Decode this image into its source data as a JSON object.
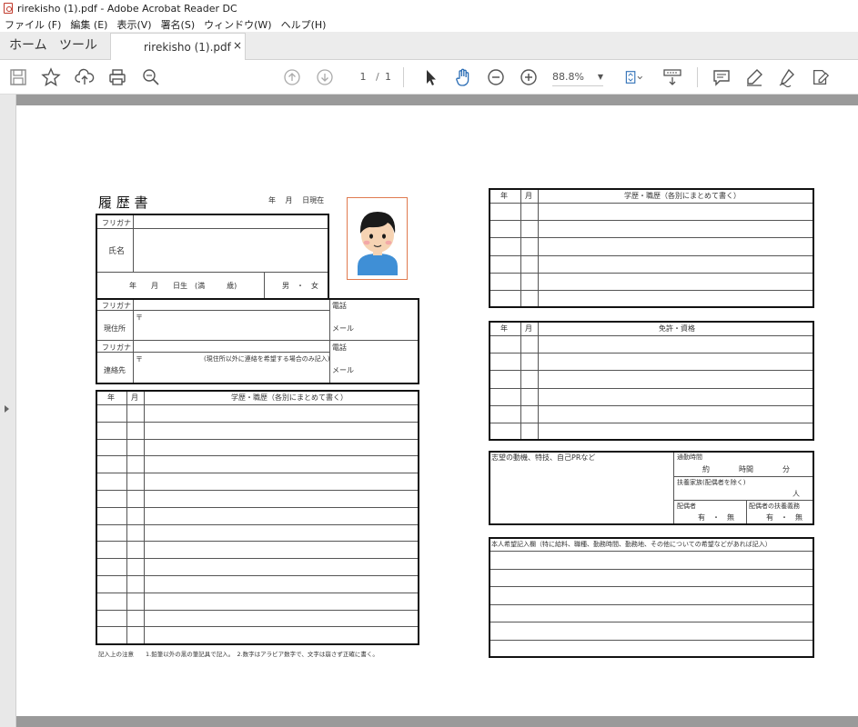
{
  "window": {
    "title": "rirekisho (1).pdf - Adobe Acrobat Reader DC"
  },
  "menu": [
    "ファイル (F)",
    "編集 (E)",
    "表示(V)",
    "署名(S)",
    "ウィンドウ(W)",
    "ヘルプ(H)"
  ],
  "tabs": {
    "home": "ホーム",
    "tools": "ツール",
    "document": "rirekisho (1).pdf",
    "close": "×"
  },
  "toolbar": {
    "page_current": "1",
    "page_sep": "/",
    "page_total": "1",
    "zoom": "88.8%"
  },
  "resume": {
    "title": "履 歴 書",
    "date_label": "年　 月　 日現在",
    "furigana": "フリガナ",
    "name_label": "氏名",
    "birth_row": "年　　月　　日生　(満　　　歳)",
    "gender": "男　・　女",
    "address_label": "現住所",
    "postal": "〒",
    "phone": "電話",
    "mail": "メール",
    "contact_label": "連絡先",
    "contact_note": "(現住所以外に連絡を希望する場合のみ記入)",
    "year": "年",
    "month": "月",
    "history_header": "学歴・職歴（各別にまとめて書く）",
    "license_header": "免許・資格",
    "motivation": "志望の動機、特技、自己PRなど",
    "commute": "通勤時間",
    "commute_value": "約　　　　時間　　　　分",
    "dependents": "扶養家族(配偶者を除く)",
    "dependents_unit": "人",
    "spouse": "配偶者",
    "spouse_support": "配偶者の扶養義務",
    "yes_no": "有　・　無",
    "wish": "本人希望記入欄（特に給料、職種、勤務時間、勤務地、その他についての希望などがあれば記入）",
    "footnote": "記入上の注意　　1.鉛筆以外の黒の筆記具で記入。　2.数字はアラビア数字で、文字は崩さず正確に書く。"
  },
  "colors": {
    "photo_border": "#e07a4f",
    "avatar_shirt": "#3f8fd6",
    "avatar_hair": "#1a1a1a",
    "avatar_skin": "#f6d3b3"
  }
}
